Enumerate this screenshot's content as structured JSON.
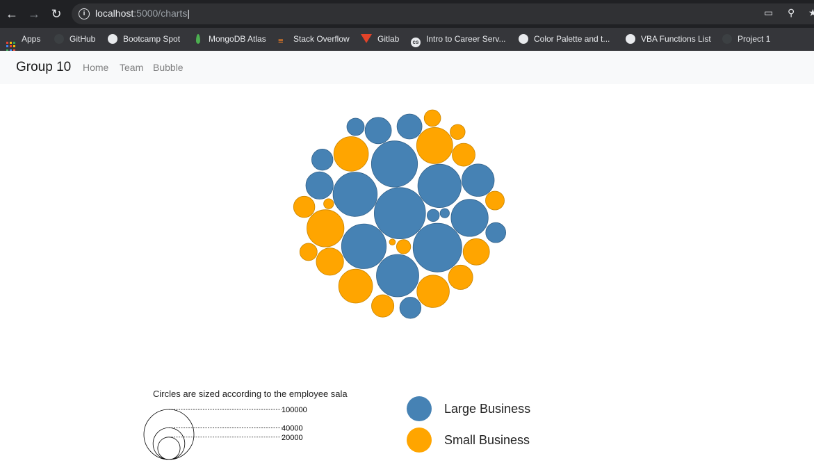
{
  "browser": {
    "url_host": "localhost",
    "url_path": ":5000/charts",
    "bookmarks": [
      {
        "label": "Apps",
        "icon": "apps-grid-icon"
      },
      {
        "label": "GitHub",
        "icon": "github-icon"
      },
      {
        "label": "Bootcamp Spot",
        "icon": "globe-icon"
      },
      {
        "label": "MongoDB Atlas",
        "icon": "mongodb-leaf-icon"
      },
      {
        "label": "Stack Overflow",
        "icon": "stack-overflow-icon"
      },
      {
        "label": "Gitlab",
        "icon": "gitlab-icon"
      },
      {
        "label": "Intro to Career Serv...",
        "icon": "cs-icon"
      },
      {
        "label": "Color Palette and t...",
        "icon": "globe-icon"
      },
      {
        "label": "VBA Functions List",
        "icon": "globe-icon"
      },
      {
        "label": "Project 1",
        "icon": "github-icon"
      }
    ]
  },
  "navbar": {
    "brand": "Group 10",
    "links": [
      "Home",
      "Team",
      "Bubble"
    ]
  },
  "colors": {
    "large": "#4682b4",
    "small": "#ffa500"
  },
  "chart_data": {
    "type": "bubble",
    "size_legend_title": "Circles are sized according to the employee salary ($)",
    "size_legend_values": [
      100000,
      40000,
      20000
    ],
    "legend": [
      {
        "name": "Large Business",
        "color": "#4682b4"
      },
      {
        "name": "Small Business",
        "color": "#ffa500"
      }
    ],
    "bubbles": [
      {
        "category": "Large Business",
        "salary": 105000
      },
      {
        "category": "Large Business",
        "salary": 95000
      },
      {
        "category": "Large Business",
        "salary": 85000
      },
      {
        "category": "Large Business",
        "salary": 80000
      },
      {
        "category": "Large Business",
        "salary": 78000
      },
      {
        "category": "Large Business",
        "salary": 75000
      },
      {
        "category": "Large Business",
        "salary": 72000
      },
      {
        "category": "Large Business",
        "salary": 55000
      },
      {
        "category": "Large Business",
        "salary": 42000
      },
      {
        "category": "Large Business",
        "salary": 30000
      },
      {
        "category": "Large Business",
        "salary": 28000
      },
      {
        "category": "Large Business",
        "salary": 25000
      },
      {
        "category": "Large Business",
        "salary": 18000
      },
      {
        "category": "Large Business",
        "salary": 18000
      },
      {
        "category": "Large Business",
        "salary": 16000
      },
      {
        "category": "Large Business",
        "salary": 12000
      },
      {
        "category": "Large Business",
        "salary": 6000
      },
      {
        "category": "Large Business",
        "salary": 3500
      },
      {
        "category": "Small Business",
        "salary": 55000
      },
      {
        "category": "Small Business",
        "salary": 52000
      },
      {
        "category": "Small Business",
        "salary": 48000
      },
      {
        "category": "Small Business",
        "salary": 46000
      },
      {
        "category": "Small Business",
        "salary": 42000
      },
      {
        "category": "Small Business",
        "salary": 30000
      },
      {
        "category": "Small Business",
        "salary": 28000
      },
      {
        "category": "Small Business",
        "salary": 24000
      },
      {
        "category": "Small Business",
        "salary": 21000
      },
      {
        "category": "Small Business",
        "salary": 20000
      },
      {
        "category": "Small Business",
        "salary": 18000
      },
      {
        "category": "Small Business",
        "salary": 14000
      },
      {
        "category": "Small Business",
        "salary": 12000
      },
      {
        "category": "Small Business",
        "salary": 11000
      },
      {
        "category": "Small Business",
        "salary": 9000
      },
      {
        "category": "Small Business",
        "salary": 8000
      },
      {
        "category": "Small Business",
        "salary": 4000
      },
      {
        "category": "Small Business",
        "salary": 1500
      }
    ]
  }
}
